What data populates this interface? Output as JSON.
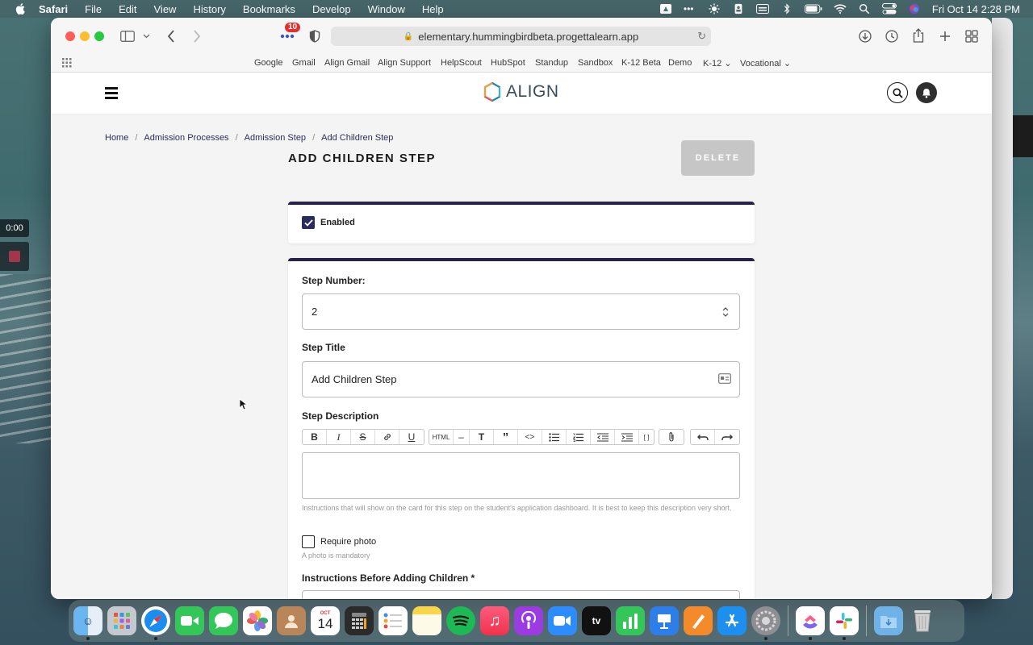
{
  "menubar": {
    "app": "Safari",
    "items": [
      "File",
      "Edit",
      "View",
      "History",
      "Bookmarks",
      "Develop",
      "Window",
      "Help"
    ],
    "clock": "Fri Oct 14  2:28 PM"
  },
  "recording": {
    "timer": "0:00"
  },
  "browser": {
    "tabs_count": "10",
    "url": "elementary.hummingbirdbeta.progettalearn.app",
    "favorites": [
      "Google",
      "Gmail",
      "Align Gmail",
      "Align Support",
      "HelpScout",
      "HubSpot",
      "Standup",
      "Sandbox",
      "K-12 Beta",
      "Demo",
      "K-12",
      "Vocational"
    ]
  },
  "app": {
    "brand": "ALIGN",
    "breadcrumb": [
      "Home",
      "Admission Processes",
      "Admission Step",
      "Add Children Step"
    ],
    "title": "ADD CHILDREN STEP",
    "delete_label": "DELETE",
    "enabled": {
      "label": "Enabled",
      "checked": true
    },
    "step_number": {
      "label": "Step Number:",
      "value": "2"
    },
    "step_title": {
      "label": "Step Title",
      "value": "Add Children Step"
    },
    "step_description": {
      "label": "Step Description",
      "help": "Instructions that will show on the card for this step on the student's application dashboard. It is best to keep this description very short."
    },
    "rte_html": "HTML",
    "require_photo": {
      "label": "Require photo",
      "checked": false,
      "help": "A photo is mandatory"
    },
    "instructions_before": {
      "label": "Instructions Before Adding Children *"
    }
  },
  "dock": {
    "calendar_month": "OCT",
    "calendar_day": "14",
    "apps": [
      "finder-icon",
      "launchpad-icon",
      "safari-icon",
      "facetime-icon",
      "messages-icon",
      "photos-icon",
      "contacts-icon",
      "calendar-icon",
      "calculator-icon",
      "reminders-icon",
      "notes-icon",
      "spotify-icon",
      "music-icon",
      "podcasts-icon",
      "zoom-icon",
      "appletv-icon",
      "numbers-icon",
      "keynote-icon",
      "pages-icon",
      "appstore-icon",
      "settings-icon",
      "clickup-icon",
      "slack-icon",
      "downloads-icon",
      "trash-icon"
    ]
  }
}
